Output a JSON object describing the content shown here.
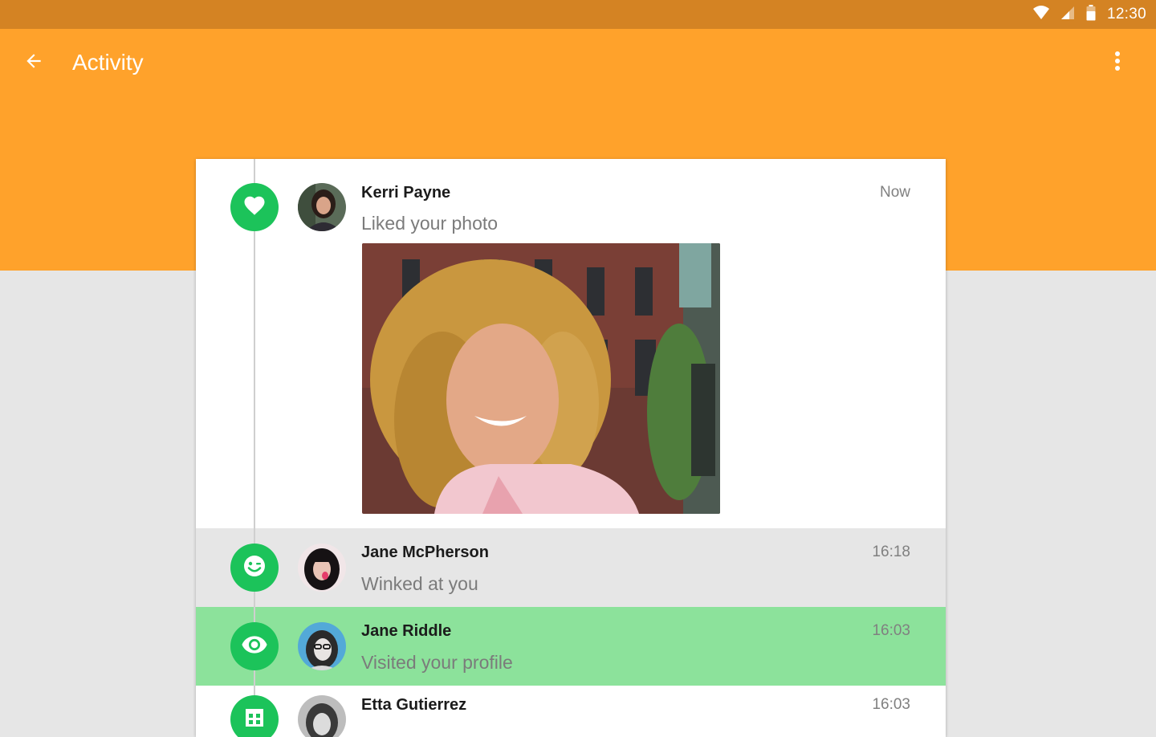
{
  "status_bar": {
    "time": "12:30"
  },
  "header": {
    "title": "Activity"
  },
  "colors": {
    "status_bar": "#d48323",
    "app_bar": "#ffa22b",
    "badge_green": "#1cc35a",
    "highlight_row": "#8ce29b",
    "grey_row": "#e6e6e6"
  },
  "activities": [
    {
      "name": "Kerri Payne",
      "action": "Liked your photo",
      "time": "Now",
      "icon": "heart-icon"
    },
    {
      "name": "Jane McPherson",
      "action": "Winked at you",
      "time": "16:18",
      "icon": "wink-face-icon"
    },
    {
      "name": "Jane Riddle",
      "action": "Visited your profile",
      "time": "16:03",
      "icon": "eye-icon"
    },
    {
      "name": "Etta Gutierrez",
      "action": "",
      "time": "16:03",
      "icon": "grid-icon"
    }
  ]
}
